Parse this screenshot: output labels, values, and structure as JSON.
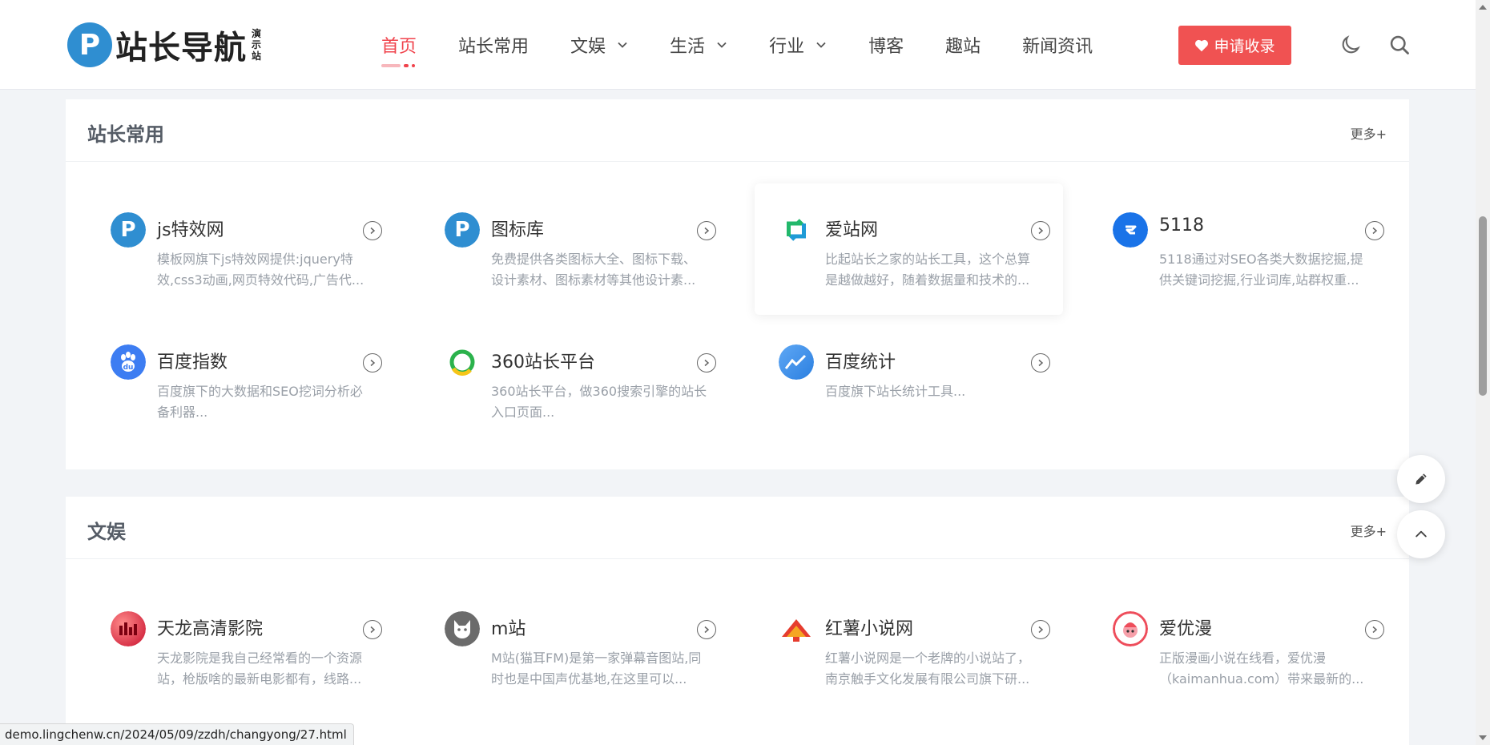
{
  "header": {
    "logo_letter": "P",
    "logo_text": "站长导航",
    "logo_sub": "演示站",
    "nav": [
      {
        "label": "首页",
        "active": true,
        "dropdown": false
      },
      {
        "label": "站长常用",
        "active": false,
        "dropdown": false
      },
      {
        "label": "文娱",
        "active": false,
        "dropdown": true
      },
      {
        "label": "生活",
        "active": false,
        "dropdown": true
      },
      {
        "label": "行业",
        "active": false,
        "dropdown": true
      },
      {
        "label": "博客",
        "active": false,
        "dropdown": false
      },
      {
        "label": "趣站",
        "active": false,
        "dropdown": false
      },
      {
        "label": "新闻资讯",
        "active": false,
        "dropdown": false
      }
    ],
    "apply_label": "申请收录",
    "accent": "#f0434c"
  },
  "sections": [
    {
      "title": "站长常用",
      "more": "更多+",
      "cards": [
        {
          "name": "js特效网",
          "desc": "模板网旗下js特效网提供:jquery特效,css3动画,网页特效代码,广告代...",
          "icon": "p-logo-icon",
          "color": "#2f8ed1"
        },
        {
          "name": "图标库",
          "desc": "免费提供各类图标大全、图标下载、设计素材、图标素材等其他设计素...",
          "icon": "p-logo-icon",
          "color": "#2f8ed1"
        },
        {
          "name": "爱站网",
          "desc": "比起站长之家的站长工具，这个总算是越做越好，随着数据量和技术的...",
          "icon": "aizhan-icon",
          "color": "#22b86b"
        },
        {
          "name": "5118",
          "desc": "5118通过对SEO各类大数据挖掘,提供关键词挖掘,行业词库,站群权重...",
          "icon": "5118-icon",
          "color": "#1a73e8"
        },
        {
          "name": "百度指数",
          "desc": "百度旗下的大数据和SEO挖词分析必备利器...",
          "icon": "baidu-paw-icon",
          "color": "#3d7df2"
        },
        {
          "name": "360站长平台",
          "desc": "360站长平台，做360搜索引擎的站长入口页面...",
          "icon": "360-icon",
          "color": "#2bb24c"
        },
        {
          "name": "百度统计",
          "desc": "百度旗下站长统计工具...",
          "icon": "baidu-tongji-icon",
          "color": "#2b7fe0"
        }
      ]
    },
    {
      "title": "文娱",
      "more": "更多+",
      "cards": [
        {
          "name": "天龙高清影院",
          "desc": "天龙影院是我自己经常看的一个资源站，枪版啥的最新电影都有，线路...",
          "icon": "tianlong-icon",
          "color": "#e0282e"
        },
        {
          "name": "m站",
          "desc": "M站(猫耳FM)是第一家弹幕音图站,同时也是中国声优基地,在这里可以...",
          "icon": "cat-ear-icon",
          "color": "#777777"
        },
        {
          "name": "红薯小说网",
          "desc": "红薯小说网是一个老牌的小说站了，南京触手文化发展有限公司旗下研...",
          "icon": "hongshu-icon",
          "color": "#e63c2e"
        },
        {
          "name": "爱优漫",
          "desc": "正版漫画小说在线看，爱优漫（kaimanhua.com）带来最新的...",
          "icon": "aiyouman-icon",
          "color": "#ee4d5b"
        }
      ]
    }
  ],
  "status_url": "demo.lingchenw.cn/2024/05/09/zzdh/changyong/27.html"
}
